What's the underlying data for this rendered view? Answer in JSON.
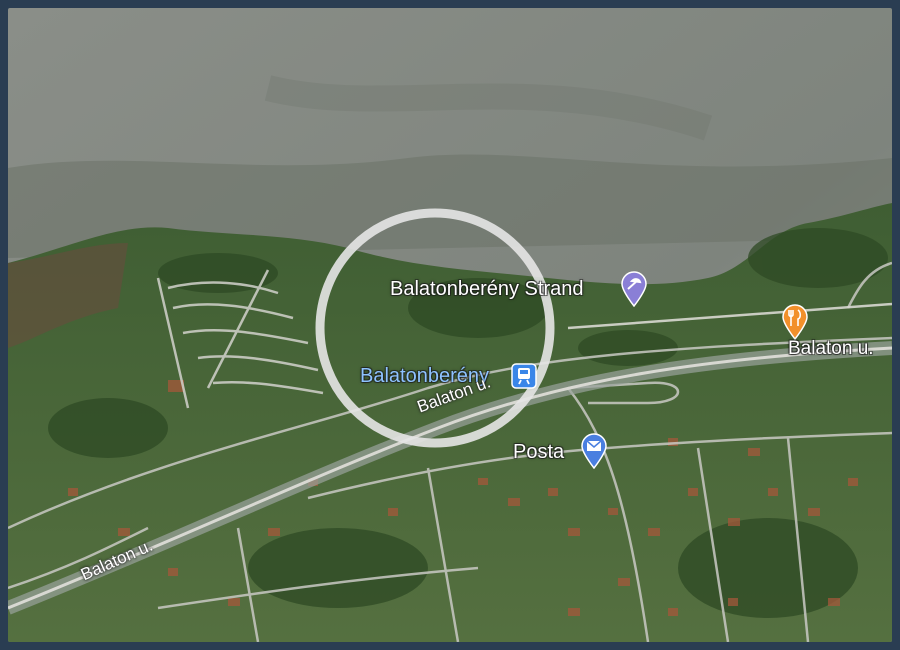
{
  "map": {
    "labels": {
      "strand": "Balatonberény Strand",
      "station": "Balatonberény",
      "post": "Posta",
      "road_east": "Balaton u.",
      "road_mid": "Balaton u.",
      "road_west": "Balaton u."
    },
    "icons": {
      "strand": "beach-icon",
      "station": "train-station-icon",
      "post": "mail-icon",
      "restaurant": "restaurant-icon"
    },
    "colors": {
      "water": "#8c928c",
      "land": "#4a6a3a",
      "pin_purple": "#8a7fd6",
      "pin_orange": "#f2902b",
      "station_blue": "#3a86e8",
      "highlight_ring": "#e6e6e6"
    }
  }
}
